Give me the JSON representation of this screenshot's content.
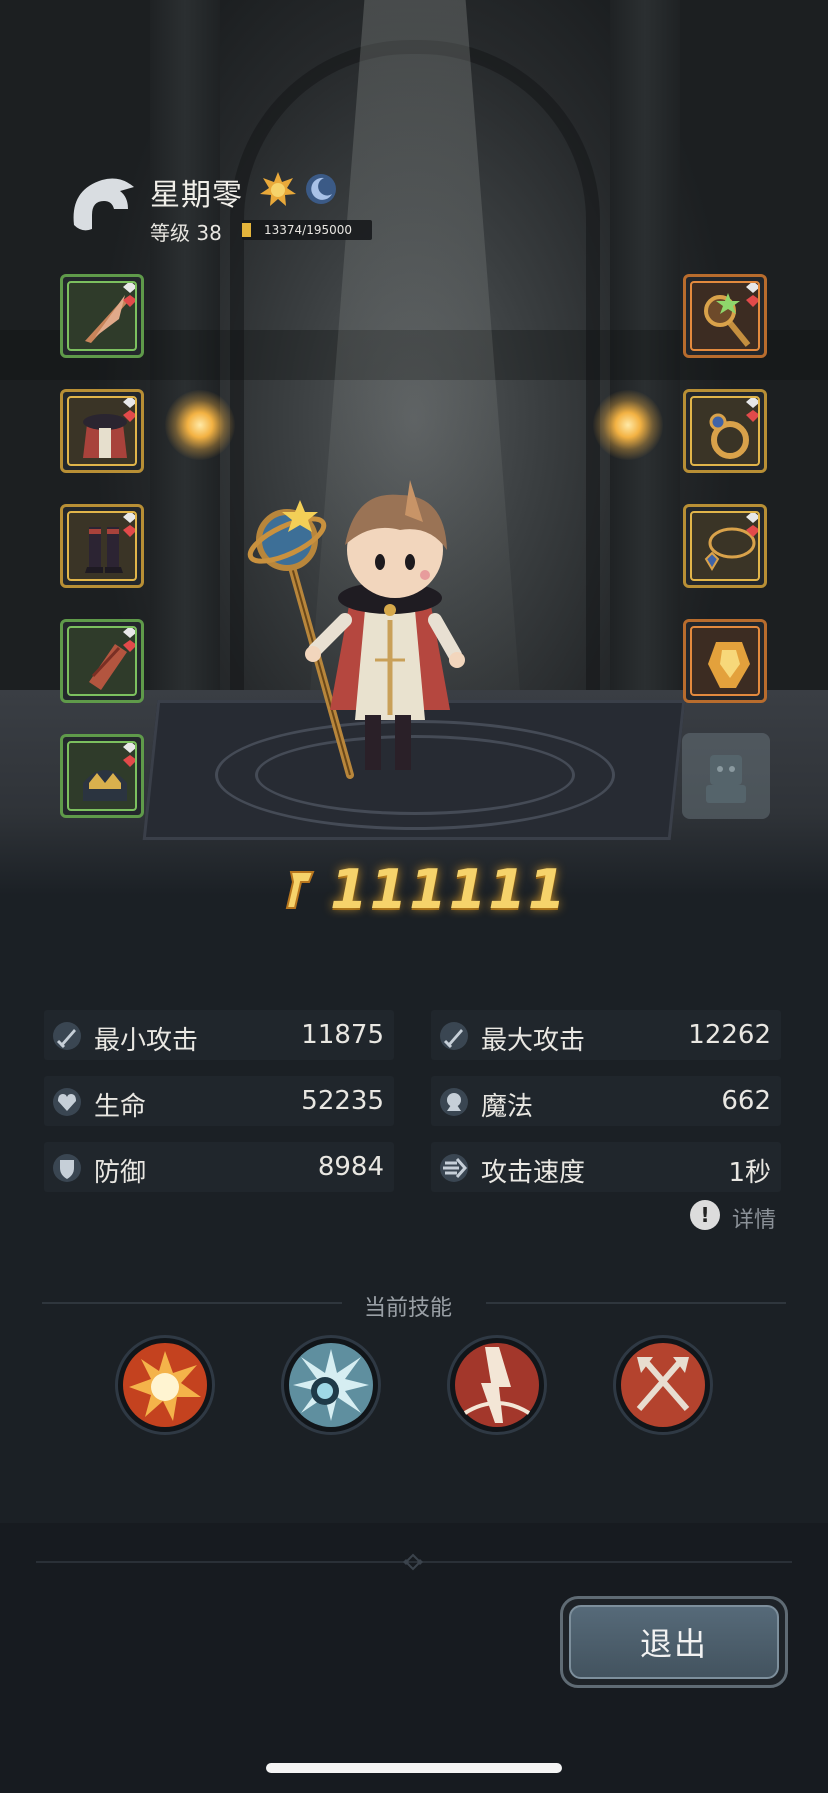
{
  "player": {
    "name": "星期零",
    "level_text": "等级 38",
    "xp_text": "13374/195000",
    "xp_progress": 0.0686
  },
  "icons": {
    "avatar": "helmet-silhouette-icon",
    "badges": [
      "sun-badge-icon",
      "moon-badge-icon"
    ],
    "power": "power-icon"
  },
  "equipment": {
    "left": [
      {
        "item": "feather-weapon-icon",
        "rarity": "green"
      },
      {
        "item": "armor-cloak-icon",
        "rarity": "gold"
      },
      {
        "item": "boots-icon",
        "rarity": "gold"
      },
      {
        "item": "bracer-icon",
        "rarity": "green"
      },
      {
        "item": "crown-helmet-icon",
        "rarity": "green"
      }
    ],
    "right": [
      {
        "item": "staff-orb-icon",
        "rarity": "orange"
      },
      {
        "item": "ring-icon",
        "rarity": "gold"
      },
      {
        "item": "necklace-icon",
        "rarity": "gold"
      },
      {
        "item": "gem-crystal-icon",
        "rarity": "orange"
      }
    ],
    "locked_slot": "locked-figure-icon"
  },
  "power": "111111",
  "stats": [
    {
      "icon": "sword-icon",
      "label": "最小攻击",
      "value": "11875"
    },
    {
      "icon": "sword-icon",
      "label": "最大攻击",
      "value": "12262"
    },
    {
      "icon": "heart-icon",
      "label": "生命",
      "value": "52235"
    },
    {
      "icon": "magic-icon",
      "label": "魔法",
      "value": "662"
    },
    {
      "icon": "shield-icon",
      "label": "防御",
      "value": "8984"
    },
    {
      "icon": "speed-icon",
      "label": "攻击速度",
      "value": "1秒"
    }
  ],
  "details_label": "详情",
  "skills_title": "当前技能",
  "skills": [
    "explosion-skill-icon",
    "ice-burst-skill-icon",
    "lightning-skill-icon",
    "crossed-axes-skill-icon"
  ],
  "exit_label": "退出",
  "colors": {
    "rarity_green": "#7cc05f",
    "rarity_gold": "#e1b54a",
    "rarity_orange": "#e38a3e",
    "power_gold": "#f6d36b",
    "background": "#1b2025"
  }
}
